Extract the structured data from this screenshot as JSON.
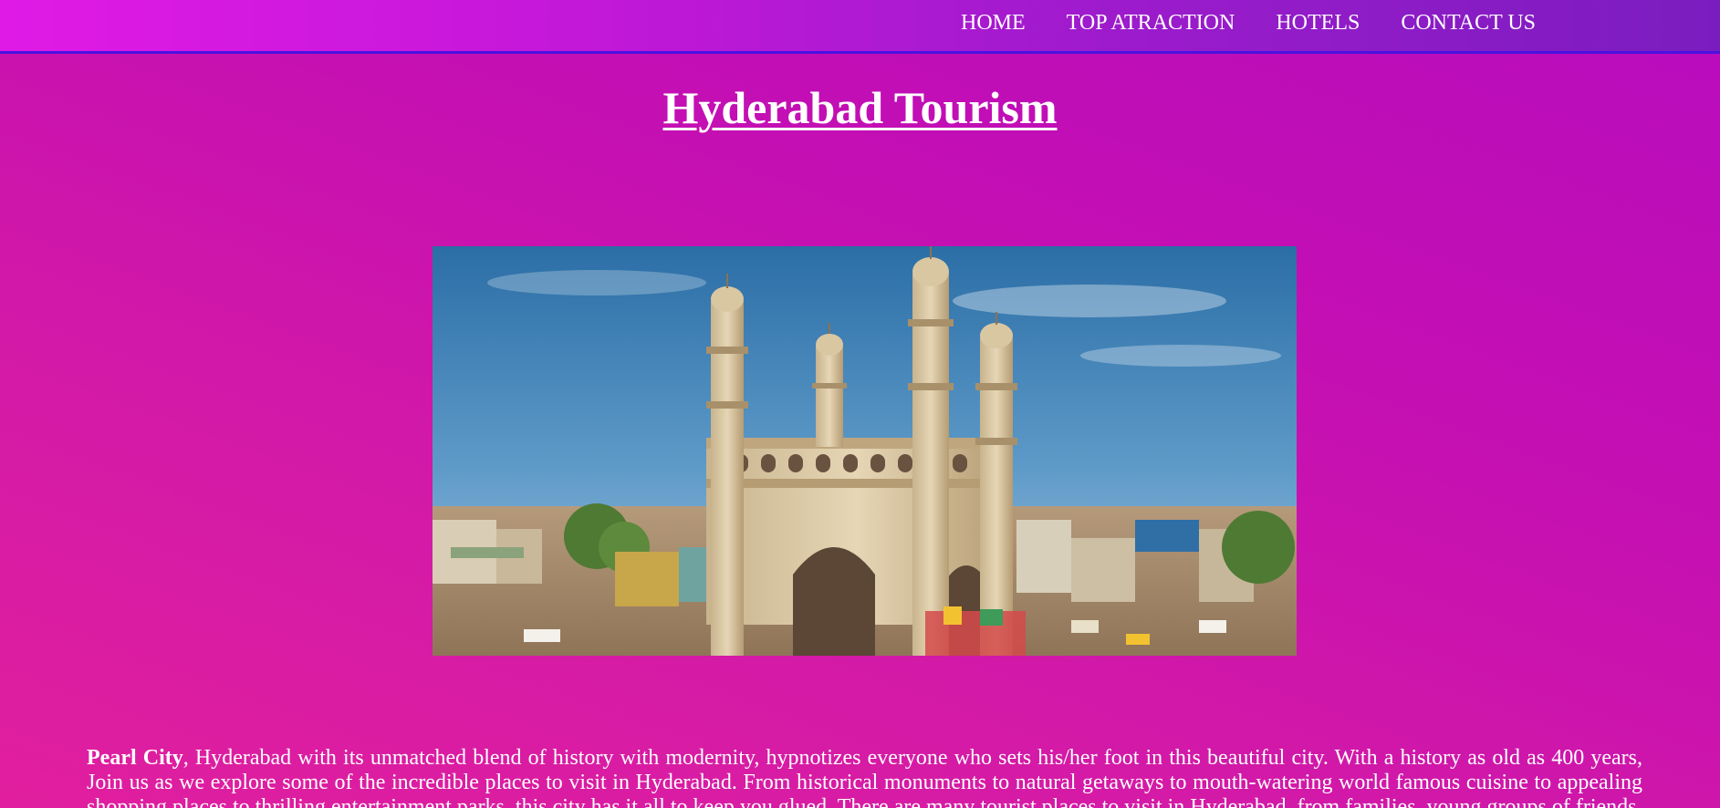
{
  "nav": {
    "items": [
      {
        "label": "HOME"
      },
      {
        "label": "TOP ATRACTION"
      },
      {
        "label": "HOTELS"
      },
      {
        "label": "CONTACT US"
      }
    ]
  },
  "page": {
    "title": "Hyderabad Tourism"
  },
  "hero": {
    "subject": "charminar-photo"
  },
  "intro": {
    "bold_lead": "Pearl City",
    "text": ", Hyderabad with its unmatched blend of history with modernity, hypnotizes everyone who sets his/her foot in this beautiful city. With a history as old as 400 years, Join us as we explore some of the incredible places to visit in Hyderabad. From historical monuments to natural getaways to mouth-watering world famous cuisine to appealing shopping places to thrilling entertainment parks, this city has it all to keep you glued. There are many tourist places to visit in Hyderabad, from families, young groups of friends"
  },
  "colors": {
    "nav_start": "#e01ae6",
    "nav_end": "#7a1dbf",
    "nav_border": "#4a12e0",
    "body_bg": "#c40fb3",
    "text": "#ffffff"
  }
}
